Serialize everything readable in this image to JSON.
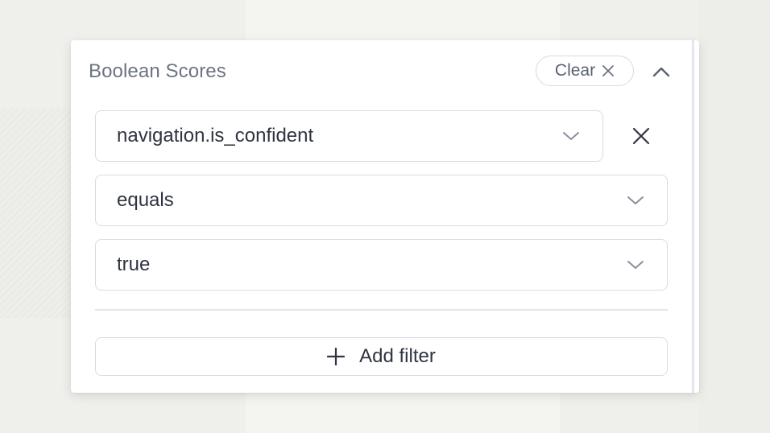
{
  "panel": {
    "title": "Boolean Scores",
    "clear_label": "Clear",
    "collapse_icon": "chevron-up-icon"
  },
  "filter": {
    "field_value": "navigation.is_confident",
    "operator_value": "equals",
    "value_value": "true",
    "remove_icon": "close-icon"
  },
  "add_filter_label": "Add filter",
  "colors": {
    "title": "#6b7383",
    "text": "#2f3440",
    "border": "#d9dce3",
    "chevron": "#8a909c"
  }
}
